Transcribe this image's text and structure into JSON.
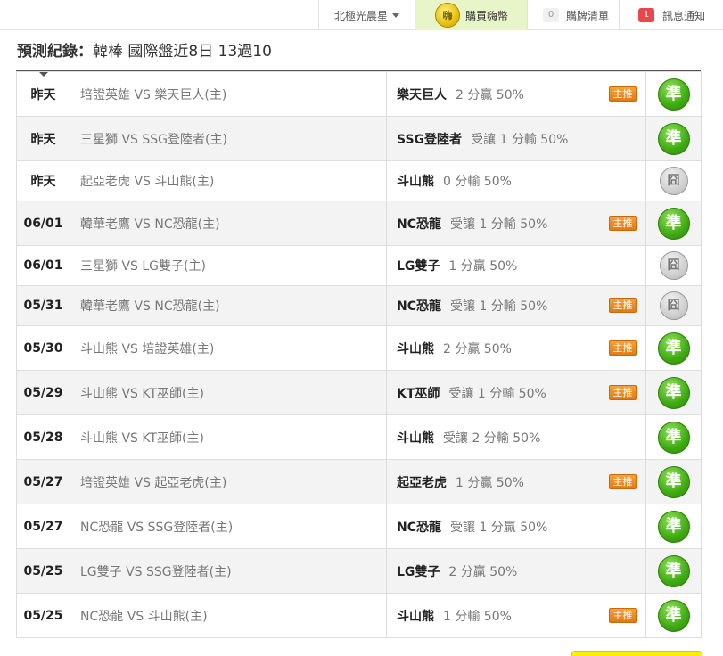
{
  "topbar": {
    "user_label": "北極光晨星",
    "buy_coin_icon": "嗨",
    "buy_label": "購買嗨幣",
    "list_count": "0",
    "list_label": "購牌清單",
    "msg_count": "1",
    "msg_label": "訊息通知"
  },
  "header": {
    "title_label": "預測紀錄：",
    "title_rest": "韓棒 國際盤近8日 13過10"
  },
  "badge_label": "主推",
  "rows": [
    {
      "date": "昨天",
      "match": "培證英雄 VS 樂天巨人(主)",
      "team": "樂天巨人",
      "line": "2 分贏 50%",
      "badge": true,
      "result": "準",
      "win": true
    },
    {
      "date": "昨天",
      "match": "三星獅 VS SSG登陸者(主)",
      "team": "SSG登陸者",
      "line": "受讓 1 分輸 50%",
      "badge": false,
      "result": "準",
      "win": true
    },
    {
      "date": "昨天",
      "match": "起亞老虎 VS 斗山熊(主)",
      "team": "斗山熊",
      "line": "0 分輸 50%",
      "badge": false,
      "result": "囧",
      "win": false
    },
    {
      "date": "06/01",
      "match": "韓華老鷹 VS NC恐龍(主)",
      "team": "NC恐龍",
      "line": "受讓 1 分輸 50%",
      "badge": true,
      "result": "準",
      "win": true
    },
    {
      "date": "06/01",
      "match": "三星獅 VS LG雙子(主)",
      "team": "LG雙子",
      "line": "1 分贏 50%",
      "badge": false,
      "result": "囧",
      "win": false
    },
    {
      "date": "05/31",
      "match": "韓華老鷹 VS NC恐龍(主)",
      "team": "NC恐龍",
      "line": "受讓 1 分輸 50%",
      "badge": true,
      "result": "囧",
      "win": false
    },
    {
      "date": "05/30",
      "match": "斗山熊 VS 培證英雄(主)",
      "team": "斗山熊",
      "line": "2 分贏 50%",
      "badge": true,
      "result": "準",
      "win": true
    },
    {
      "date": "05/29",
      "match": "斗山熊 VS KT巫師(主)",
      "team": "KT巫師",
      "line": "受讓 1 分輸 50%",
      "badge": true,
      "result": "準",
      "win": true
    },
    {
      "date": "05/28",
      "match": "斗山熊 VS KT巫師(主)",
      "team": "斗山熊",
      "line": "受讓 2 分輸 50%",
      "badge": false,
      "result": "準",
      "win": true
    },
    {
      "date": "05/27",
      "match": "培證英雄 VS 起亞老虎(主)",
      "team": "起亞老虎",
      "line": "1 分贏 50%",
      "badge": true,
      "result": "準",
      "win": true
    },
    {
      "date": "05/27",
      "match": "NC恐龍 VS SSG登陸者(主)",
      "team": "NC恐龍",
      "line": "受讓 1 分贏 50%",
      "badge": false,
      "result": "準",
      "win": true
    },
    {
      "date": "05/25",
      "match": "LG雙子 VS SSG登陸者(主)",
      "team": "LG雙子",
      "line": "2 分贏 50%",
      "badge": false,
      "result": "準",
      "win": true
    },
    {
      "date": "05/25",
      "match": "NC恐龍 VS 斗山熊(主)",
      "team": "斗山熊",
      "line": "1 分輸 50%",
      "badge": true,
      "result": "準",
      "win": true
    }
  ]
}
